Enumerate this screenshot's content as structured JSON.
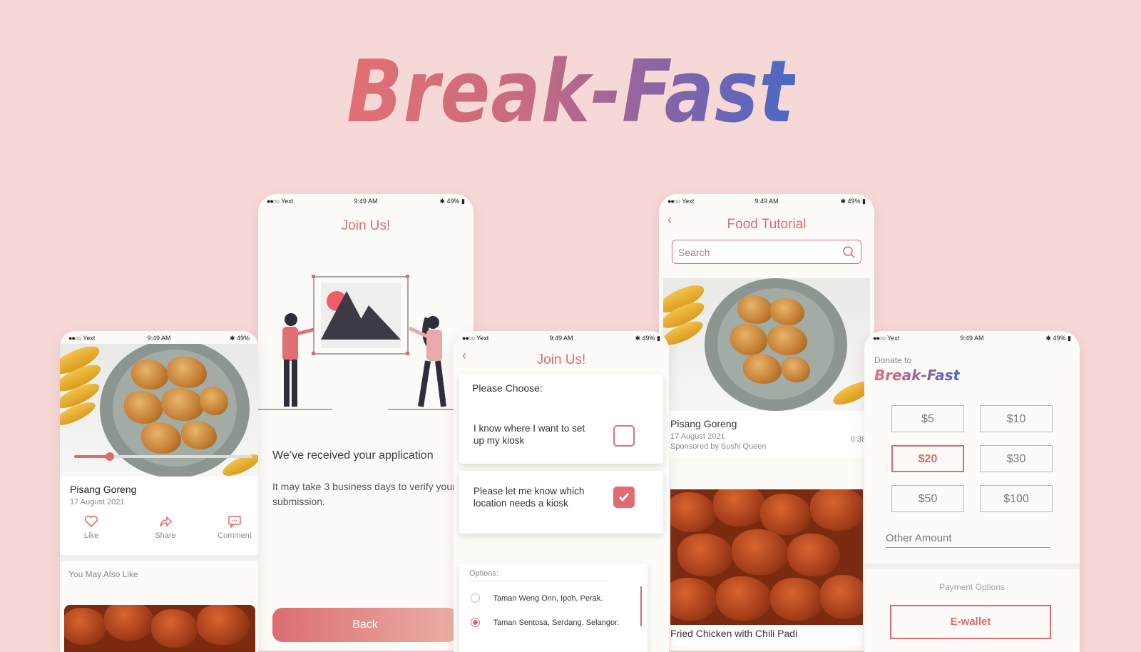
{
  "app_title": "Break-Fast",
  "status": {
    "carrier": "Yext",
    "time": "9:49 AM",
    "battery": "49%"
  },
  "screen_detail": {
    "dish_name": "Pisang Goreng",
    "date": "17 August 2021",
    "video_progress": 0.2,
    "actions": [
      {
        "label": "Like",
        "icon": "heart-icon"
      },
      {
        "label": "Share",
        "icon": "share-icon"
      },
      {
        "label": "Comment",
        "icon": "comment-icon"
      }
    ],
    "related_heading": "You May Also Like"
  },
  "screen_received": {
    "title": "Join Us!",
    "heading": "We’ve received your application",
    "body": "It may take 3 business days to verify your submission.",
    "back_label": "Back"
  },
  "screen_choose": {
    "title": "Join Us!",
    "prompt": "Please Choose:",
    "option1": "I know where I want to set up my kiosk",
    "option1_checked": false,
    "option2": "Please let me know which location needs a kiosk",
    "option2_checked": true,
    "options_label": "Options:",
    "locations": [
      {
        "name": "Taman Weng Onn, Ipoh, Perak.",
        "selected": false
      },
      {
        "name": "Taman Sentosa, Serdang, Selangor.",
        "selected": true
      }
    ]
  },
  "screen_tutorial": {
    "title": "Food Tutorial",
    "search_placeholder": "Search",
    "video1": {
      "title": "Pisang Goreng",
      "date": "17 August 2021",
      "sponsor": "Sponsored by Sushi Queen",
      "duration": "0:36"
    },
    "video2": {
      "title": "Fried Chicken with Chili Padi"
    }
  },
  "screen_donate": {
    "label": "Donate to",
    "brand": "Break-Fast",
    "amounts": [
      "$5",
      "$10",
      "$20",
      "$30",
      "$50",
      "$100"
    ],
    "selected_amount": "$20",
    "other_placeholder": "Other Amount",
    "payment_heading": "Payment Options",
    "payment_button": "E-wallet"
  },
  "colors": {
    "accent": "#e06a70",
    "background": "#f6d9d7",
    "screen": "#fcfbf8",
    "brand_gradient_end": "#4a68c6"
  }
}
